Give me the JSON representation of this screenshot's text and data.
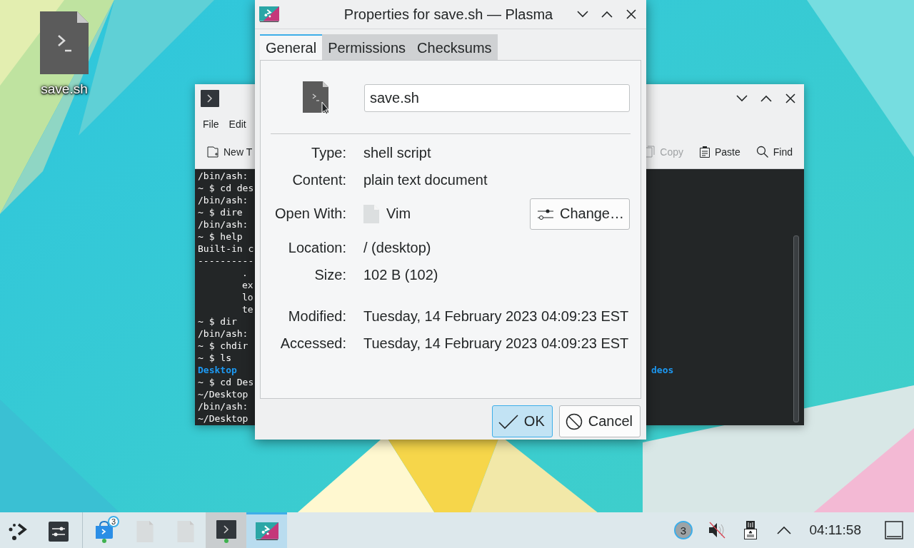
{
  "desktop_icons": [
    {
      "label": "save.sh"
    }
  ],
  "terminal": {
    "menu": [
      "File",
      "Edit"
    ],
    "toolbar": [
      {
        "label": "New T",
        "kind": "new-tab",
        "disabled": false
      },
      {
        "label": "Copy",
        "kind": "copy",
        "disabled": true
      },
      {
        "label": "Paste",
        "kind": "paste",
        "disabled": false
      },
      {
        "label": "Find",
        "kind": "find",
        "disabled": false
      }
    ],
    "lines": [
      {
        "text": "/bin/ash:",
        "kind": "plain"
      },
      {
        "text": "~ $ cd des",
        "kind": "plain"
      },
      {
        "text": "/bin/ash:",
        "kind": "plain"
      },
      {
        "text": "~ $ dire",
        "kind": "plain"
      },
      {
        "text": "/bin/ash:",
        "kind": "plain"
      },
      {
        "text": "~ $ help",
        "kind": "plain"
      },
      {
        "text": "Built-in c",
        "kind": "plain"
      },
      {
        "text": "----------",
        "kind": "plain"
      },
      {
        "text": ".",
        "kind": "indented"
      },
      {
        "text": "ex",
        "kind": "indented"
      },
      {
        "text": "lo",
        "kind": "indented"
      },
      {
        "text": "te",
        "kind": "indented"
      },
      {
        "text": "~ $ dir",
        "kind": "plain"
      },
      {
        "text": "/bin/ash:",
        "kind": "plain"
      },
      {
        "text": "~ $ chdir",
        "kind": "plain"
      },
      {
        "text": "~ $ ls",
        "kind": "plain"
      },
      {
        "text": "Desktop",
        "kind": "dir",
        "column_2": "deos"
      },
      {
        "text": "~ $ cd Des",
        "kind": "plain"
      },
      {
        "text": "~/Desktop",
        "kind": "plain"
      },
      {
        "text": "/bin/ash:",
        "kind": "plain"
      },
      {
        "text": "~/Desktop",
        "kind": "plain"
      }
    ]
  },
  "dialog": {
    "title": "Properties for save.sh — Plasma",
    "tabs": [
      {
        "label": "General",
        "selected": true
      },
      {
        "label": "Permissions",
        "selected": false
      },
      {
        "label": "Checksums",
        "selected": false
      }
    ],
    "name_field": {
      "value": "save.sh"
    },
    "rows": [
      {
        "label": "Type:",
        "value": "shell script",
        "kind": "text"
      },
      {
        "label": "Content:",
        "value": "plain text document",
        "kind": "text"
      },
      {
        "label": "Open With:",
        "value": "Vim",
        "kind": "app",
        "button": "Change…"
      },
      {
        "label": "Location:",
        "value": "/ (desktop)",
        "kind": "text"
      },
      {
        "label": "Size:",
        "value": "102 B (102)",
        "kind": "text"
      }
    ],
    "time_rows": [
      {
        "label": "Modified:",
        "value": "Tuesday, 14 February 2023 04:09:23 EST"
      },
      {
        "label": "Accessed:",
        "value": "Tuesday, 14 February 2023 04:09:23 EST"
      }
    ],
    "buttons": [
      {
        "label": "OK",
        "kind": "ok",
        "default": true
      },
      {
        "label": "Cancel",
        "kind": "cancel",
        "default": false
      }
    ]
  },
  "taskbar": {
    "tasks": [
      {
        "kind": "store",
        "badge": "3",
        "selected": false,
        "highlighted": false
      },
      {
        "kind": "file",
        "selected": false,
        "highlighted": false
      },
      {
        "kind": "file",
        "selected": false,
        "highlighted": false
      },
      {
        "kind": "terminal",
        "selected": false,
        "highlighted": true
      },
      {
        "kind": "plasma",
        "selected": true,
        "highlighted": false
      }
    ],
    "notifications": "3",
    "clock": "04:11:58"
  }
}
